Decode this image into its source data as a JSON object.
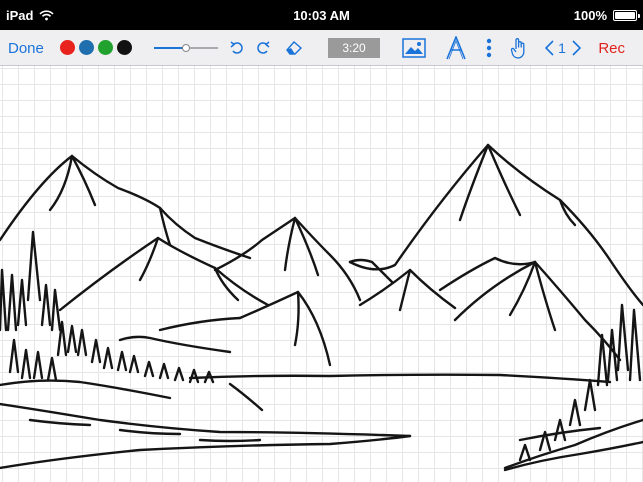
{
  "status_bar": {
    "device": "iPad",
    "time": "10:03 AM",
    "battery": "100%",
    "battery_level": 1.0
  },
  "toolbar": {
    "done_label": "Done",
    "colors": [
      {
        "name": "red",
        "hex": "#e8221c"
      },
      {
        "name": "blue",
        "hex": "#1f6fae"
      },
      {
        "name": "green",
        "hex": "#21a12e"
      },
      {
        "name": "black",
        "hex": "#111111"
      }
    ],
    "stroke_width_level": 0.5,
    "timer": "3:20",
    "page_number": "1",
    "rec_label": "Rec",
    "icons": [
      "undo-icon",
      "redo-icon",
      "eraser-icon",
      "insert-image-icon",
      "text-tool-icon",
      "more-options-icon",
      "hand-tool-icon",
      "previous-page-icon",
      "next-page-icon"
    ],
    "accent_color": "#1a73d9",
    "rec_color": "#e0241c"
  },
  "canvas": {
    "drawing": "mountain-landscape-sketch",
    "grid": true
  }
}
